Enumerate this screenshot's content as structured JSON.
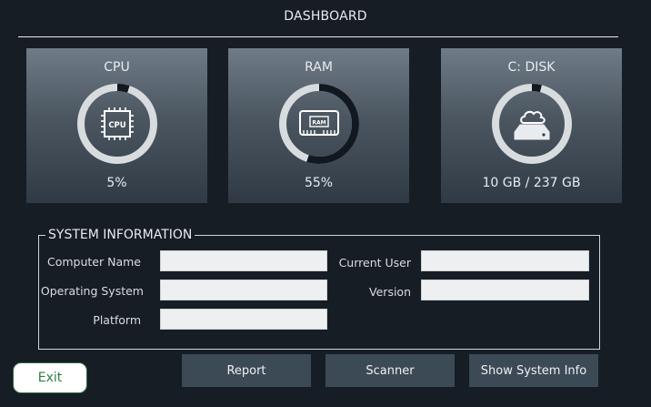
{
  "header": {
    "title": "DASHBOARD"
  },
  "cards": [
    {
      "title": "CPU",
      "value": "5%",
      "usage_fraction": 0.05,
      "icon": "cpu-chip-icon",
      "icon_text": "CPU"
    },
    {
      "title": "RAM",
      "value": "55%",
      "usage_fraction": 0.55,
      "icon": "ram-module-icon",
      "icon_text": "RAM"
    },
    {
      "title": "C: DISK",
      "value": "10 GB / 237 GB",
      "usage_fraction": 0.04,
      "icon": "disk-cloud-icon"
    }
  ],
  "system_info": {
    "title": "SYSTEM INFORMATION",
    "fields": {
      "computer_name": {
        "label": "Computer Name",
        "value": ""
      },
      "operating_system": {
        "label": "Operating System",
        "value": ""
      },
      "platform": {
        "label": "Platform",
        "value": ""
      },
      "current_user": {
        "label": "Current User",
        "value": ""
      },
      "version": {
        "label": "Version",
        "value": ""
      }
    }
  },
  "buttons": {
    "exit": "Exit",
    "report": "Report",
    "scanner": "Scanner",
    "show_system_info": "Show System Info"
  },
  "colors": {
    "background": "#161d24",
    "gauge_track": "#d9dcdf",
    "gauge_fill": "#111820",
    "button": "#3c4a56",
    "exit_text": "#2e7d46"
  }
}
